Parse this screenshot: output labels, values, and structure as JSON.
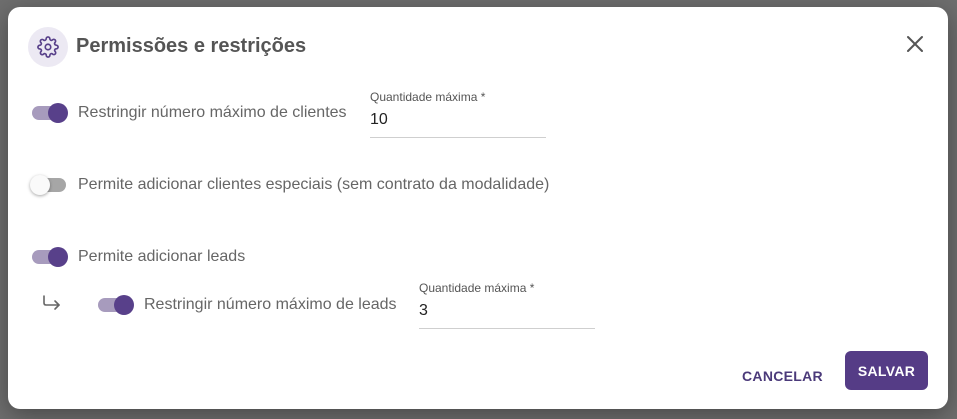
{
  "dialog": {
    "title": "Permissões e restrições",
    "title_icon": "gear-icon",
    "close_icon": "close-icon"
  },
  "settings": [
    {
      "label": "Restringir número máximo de clientes",
      "enabled": true,
      "field": {
        "label": "Quantidade máxima *",
        "value": "10"
      }
    },
    {
      "label": "Permite adicionar clientes especiais (sem contrato da modalidade)",
      "enabled": false
    },
    {
      "label": "Permite adicionar leads",
      "enabled": true,
      "sub": {
        "label": "Restringir número máximo de leads",
        "enabled": true,
        "field": {
          "label": "Quantidade máxima *",
          "value": "3"
        }
      }
    }
  ],
  "actions": {
    "cancel_label": "CANCELAR",
    "save_label": "SALVAR"
  },
  "colors": {
    "accent": "#553c86",
    "toggle_track_on": "#a79bbd",
    "toggle_thumb_on": "#58408a"
  }
}
